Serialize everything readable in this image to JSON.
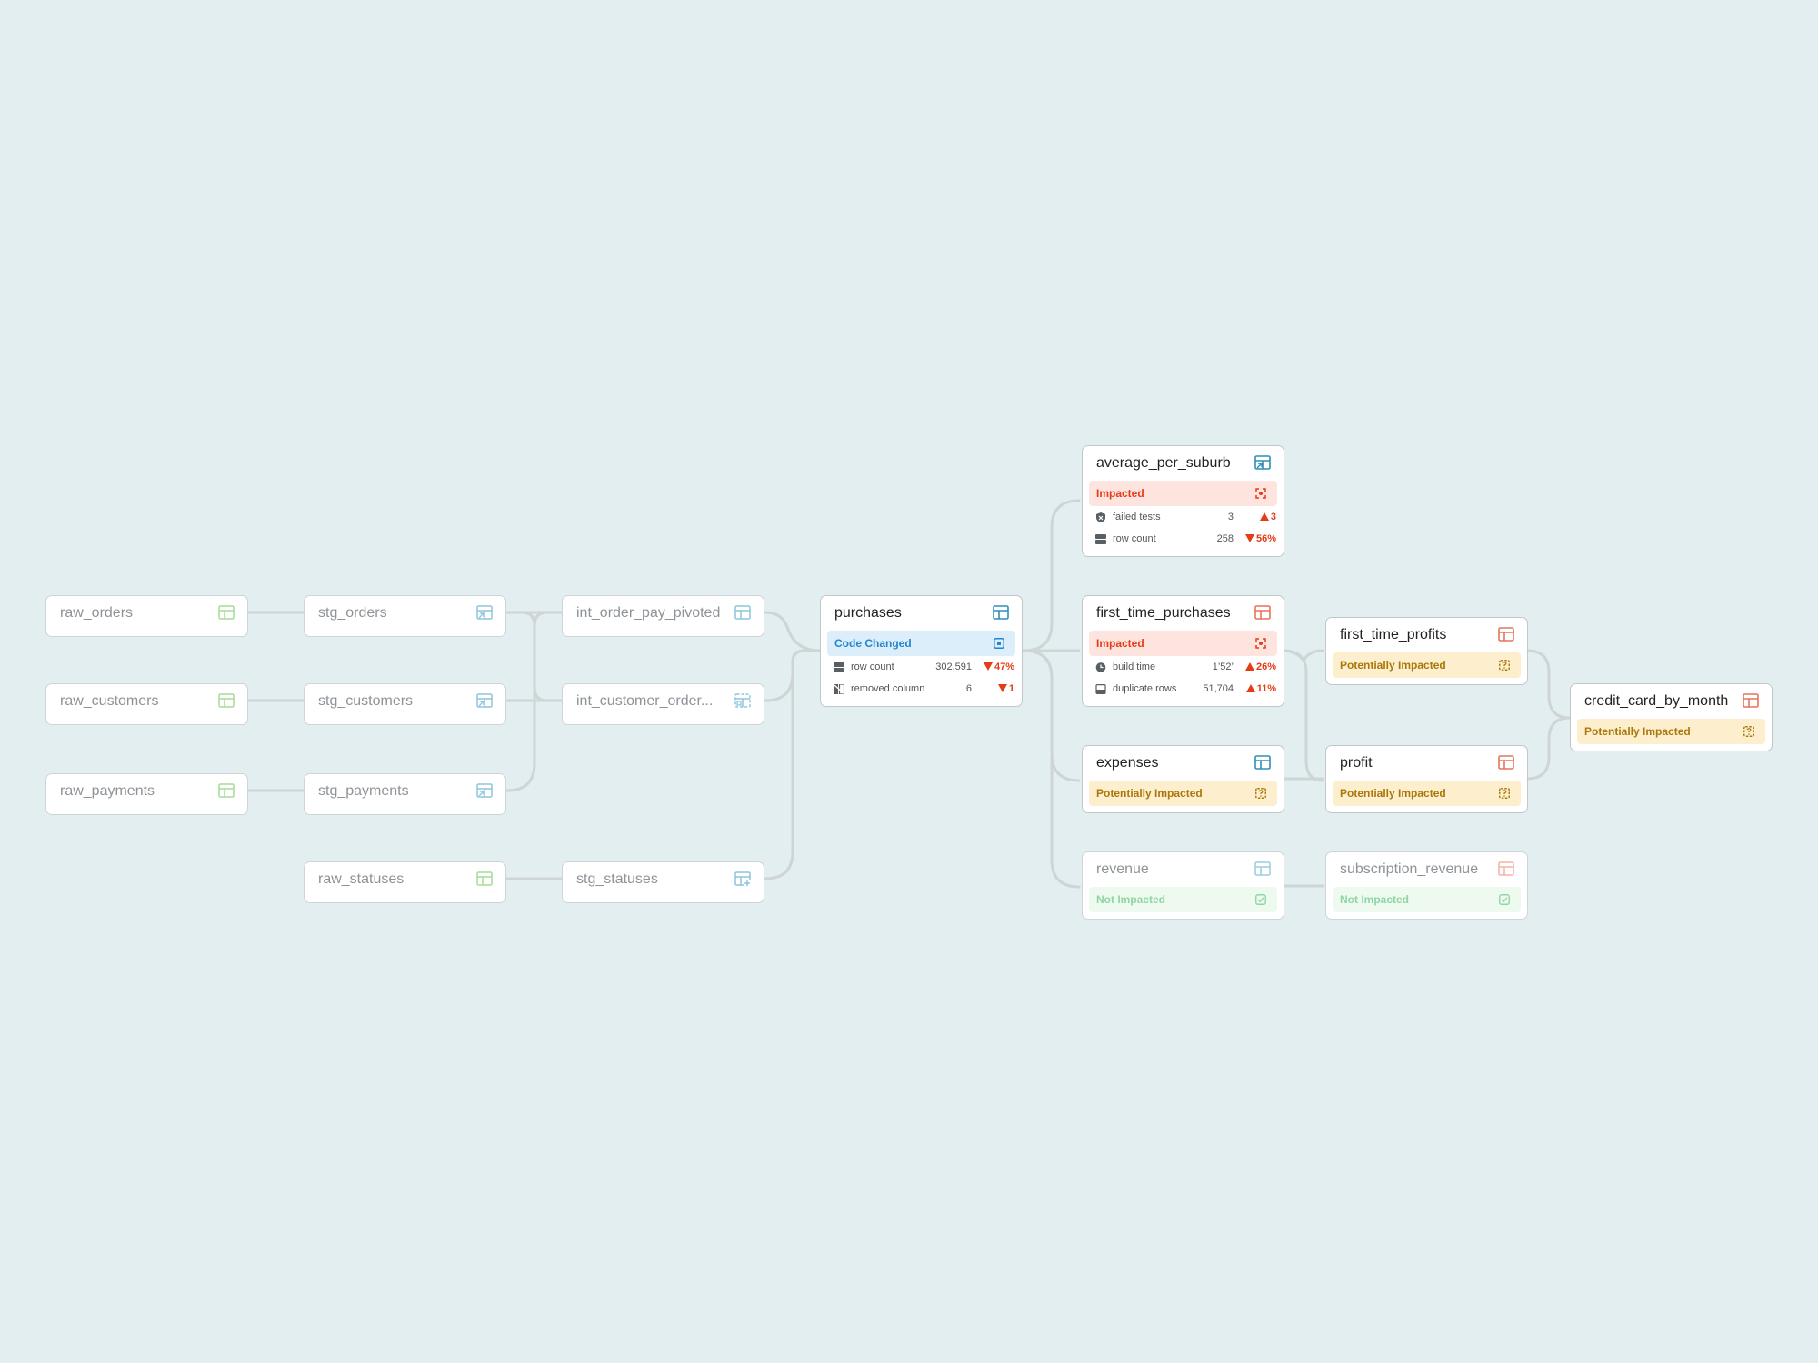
{
  "colors": {
    "background": "#e2eef0",
    "edge": "#cfd4d7",
    "code_changed": "#2185d0",
    "impacted": "#e63b16",
    "potentially_impacted": "#a9780a",
    "not_impacted": "#8fd6a3"
  },
  "nodes": {
    "raw_orders": {
      "name": "raw_orders",
      "icon": "table-icon"
    },
    "raw_customers": {
      "name": "raw_customers",
      "icon": "table-icon"
    },
    "raw_payments": {
      "name": "raw_payments",
      "icon": "table-icon"
    },
    "raw_statuses": {
      "name": "raw_statuses",
      "icon": "table-icon"
    },
    "stg_orders": {
      "name": "stg_orders",
      "icon": "view-icon"
    },
    "stg_customers": {
      "name": "stg_customers",
      "icon": "view-icon"
    },
    "stg_payments": {
      "name": "stg_payments",
      "icon": "view-icon"
    },
    "stg_statuses": {
      "name": "stg_statuses",
      "icon": "incremental-table-icon"
    },
    "int_order_pay_pivoted": {
      "name": "int_order_pay_pivoted",
      "icon": "table-icon"
    },
    "int_customer_order": {
      "name": "int_customer_order...",
      "icon": "ephemeral-icon"
    },
    "purchases": {
      "name": "purchases",
      "icon": "table-icon",
      "status": "Code Changed",
      "status_icon": "code-changed-icon",
      "metrics": [
        {
          "label": "row count",
          "value": "302,591",
          "delta": "47%",
          "direction": "down",
          "icon": "row-count-icon"
        },
        {
          "label": "removed column",
          "value": "6",
          "delta": "1",
          "direction": "down",
          "icon": "removed-column-icon"
        }
      ]
    },
    "average_per_suburb": {
      "name": "average_per_suburb",
      "icon": "view-icon",
      "status": "Impacted",
      "status_icon": "impacted-icon",
      "metrics": [
        {
          "label": "failed tests",
          "value": "3",
          "delta": "3",
          "direction": "up",
          "icon": "failed-tests-icon"
        },
        {
          "label": "row count",
          "value": "258",
          "delta": "56%",
          "direction": "down",
          "icon": "row-count-icon"
        }
      ]
    },
    "first_time_purchases": {
      "name": "first_time_purchases",
      "icon": "table-icon",
      "status": "Impacted",
      "status_icon": "impacted-icon",
      "metrics": [
        {
          "label": "build time",
          "value": "1’52’",
          "delta": "26%",
          "direction": "up",
          "icon": "build-time-icon"
        },
        {
          "label": "duplicate rows",
          "value": "51,704",
          "delta": "11%",
          "direction": "up",
          "icon": "duplicate-rows-icon"
        }
      ]
    },
    "expenses": {
      "name": "expenses",
      "icon": "table-icon",
      "status": "Potentially Impacted",
      "status_icon": "potentially-impacted-icon"
    },
    "revenue": {
      "name": "revenue",
      "icon": "table-icon",
      "status": "Not Impacted",
      "status_icon": "not-impacted-icon"
    },
    "first_time_profits": {
      "name": "first_time_profits",
      "icon": "table-icon",
      "status": "Potentially Impacted",
      "status_icon": "potentially-impacted-icon"
    },
    "profit": {
      "name": "profit",
      "icon": "table-icon",
      "status": "Potentially Impacted",
      "status_icon": "potentially-impacted-icon"
    },
    "subscription_revenue": {
      "name": "subscription_revenue",
      "icon": "table-icon",
      "status": "Not Impacted",
      "status_icon": "not-impacted-icon"
    },
    "credit_card_by_month": {
      "name": "credit_card_by_month",
      "icon": "table-icon",
      "status": "Potentially Impacted",
      "status_icon": "potentially-impacted-icon"
    }
  }
}
